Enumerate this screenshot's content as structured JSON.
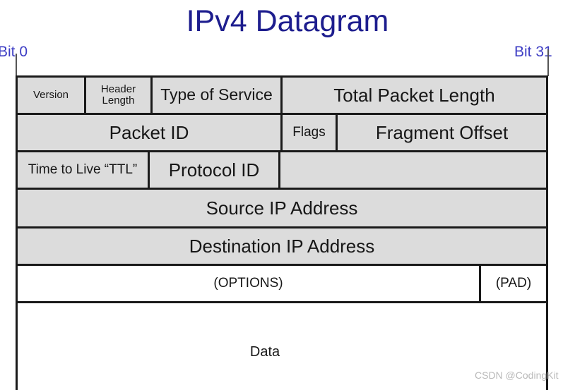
{
  "title": "IPv4 Datagram",
  "bits": {
    "left_label": "Bit 0",
    "right_label": "Bit 31"
  },
  "diagram": {
    "rows": [
      {
        "name": "row-1",
        "cells": [
          {
            "label": "Version",
            "size": "small"
          },
          {
            "label": "Header Length",
            "size": "small"
          },
          {
            "label": "Type of Service",
            "size": "large"
          },
          {
            "label": "Total Packet Length",
            "size": "xlarge"
          }
        ]
      },
      {
        "name": "row-2",
        "cells": [
          {
            "label": "Packet ID",
            "size": "xlarge"
          },
          {
            "label": "Flags",
            "size": "med"
          },
          {
            "label": "Fragment Offset",
            "size": "xlarge"
          }
        ]
      },
      {
        "name": "row-3",
        "cells": [
          {
            "label": "Time to Live “TTL”",
            "size": "med"
          },
          {
            "label": "Protocol ID",
            "size": "xlarge"
          },
          {
            "label": "",
            "size": "med"
          }
        ]
      },
      {
        "name": "row-4",
        "cells": [
          {
            "label": "Source IP Address",
            "size": "xlarge"
          }
        ]
      },
      {
        "name": "row-5",
        "cells": [
          {
            "label": "Destination IP Address",
            "size": "xlarge"
          }
        ]
      },
      {
        "name": "row-6",
        "cells": [
          {
            "label": "(OPTIONS)",
            "size": "med"
          },
          {
            "label": "(PAD)",
            "size": "med"
          }
        ]
      }
    ],
    "data_label": "Data"
  },
  "watermark": "CSDN @CodingKit",
  "colors": {
    "title": "#1d1d8e",
    "bit_label": "#3d3dc4",
    "cell_fill": "#dcdcdc",
    "border": "#1a1a1a",
    "watermark": "#b9b9b9"
  }
}
